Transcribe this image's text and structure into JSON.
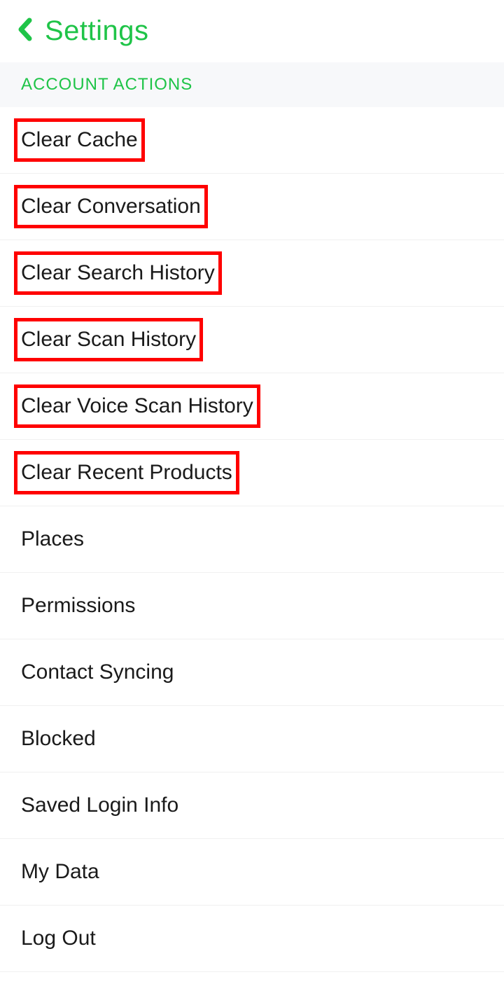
{
  "header": {
    "title": "Settings"
  },
  "section": {
    "title": "ACCOUNT ACTIONS"
  },
  "items": [
    {
      "label": "Clear Cache",
      "highlighted": true
    },
    {
      "label": "Clear Conversation",
      "highlighted": true
    },
    {
      "label": "Clear Search History",
      "highlighted": true
    },
    {
      "label": "Clear Scan History",
      "highlighted": true
    },
    {
      "label": "Clear Voice Scan History",
      "highlighted": true
    },
    {
      "label": "Clear Recent Products",
      "highlighted": true
    },
    {
      "label": "Places",
      "highlighted": false
    },
    {
      "label": "Permissions",
      "highlighted": false
    },
    {
      "label": "Contact Syncing",
      "highlighted": false
    },
    {
      "label": "Blocked",
      "highlighted": false
    },
    {
      "label": "Saved Login Info",
      "highlighted": false
    },
    {
      "label": "My Data",
      "highlighted": false
    },
    {
      "label": "Log Out",
      "highlighted": false
    }
  ]
}
